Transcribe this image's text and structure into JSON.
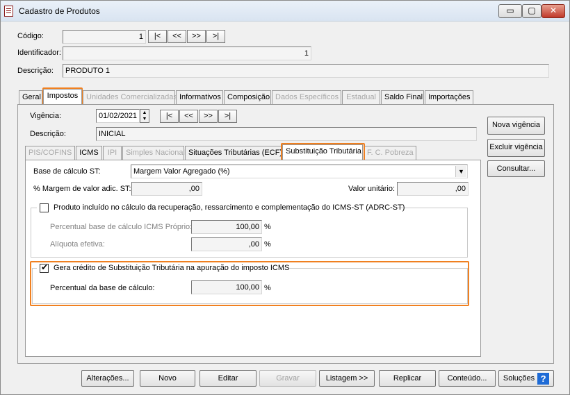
{
  "window": {
    "title": "Cadastro de Produtos",
    "minimize": "▭",
    "restore": "▢",
    "close": "✕"
  },
  "header": {
    "codigo_label": "Código:",
    "codigo_value": "1",
    "nav": [
      "|<",
      "<<",
      ">>",
      ">|"
    ],
    "identificador_label": "Identificador:",
    "identificador_value": "1",
    "descricao_label": "Descrição:",
    "descricao_value": "PRODUTO 1"
  },
  "tabs": [
    {
      "label": "Geral",
      "enabled": true
    },
    {
      "label": "Impostos",
      "enabled": true,
      "active": true
    },
    {
      "label": "Unidades Comercializadas",
      "enabled": false
    },
    {
      "label": "Informativos",
      "enabled": true
    },
    {
      "label": "Composição",
      "enabled": true
    },
    {
      "label": "Dados Específicos",
      "enabled": false
    },
    {
      "label": "Estadual",
      "enabled": false
    },
    {
      "label": "Saldo Final",
      "enabled": true
    },
    {
      "label": "Importações",
      "enabled": true
    }
  ],
  "impostos": {
    "vigencia_label": "Vigência:",
    "vigencia_value": "01/02/2021",
    "nav": [
      "|<",
      "<<",
      ">>",
      ">|"
    ],
    "descricao_label": "Descrição:",
    "descricao_value": "INICIAL",
    "side_buttons": [
      "Nova vigência",
      "Excluir vigência",
      "Consultar..."
    ]
  },
  "subtabs": [
    {
      "label": "PIS/COFINS",
      "enabled": false
    },
    {
      "label": "ICMS",
      "enabled": true
    },
    {
      "label": "IPI",
      "enabled": false
    },
    {
      "label": "Simples Nacional",
      "enabled": false
    },
    {
      "label": "Situações Tributárias (ECF)",
      "enabled": true
    },
    {
      "label": "Substituição Tributária",
      "enabled": true,
      "active": true
    },
    {
      "label": "F. C. Pobreza",
      "enabled": false
    }
  ],
  "st": {
    "base_label": "Base de cálculo ST:",
    "base_value": "Margem Valor Agregado (%)",
    "margem_label": "% Margem de valor adic. ST:",
    "margem_value": ",00",
    "valor_unit_label": "Valor unitário:",
    "valor_unit_value": ",00",
    "adrc_label": "Produto incluído no cálculo da recuperação, ressarcimento e complementação do ICMS-ST (ADRC-ST)",
    "adrc_checked": false,
    "perc_base_label": "Percentual base de cálculo ICMS Próprio:",
    "perc_base_value": "100,00",
    "aliquota_label": "Alíquota efetiva:",
    "aliquota_value": ",00",
    "percent_sign": "%",
    "gera_credito_label": "Gera crédito de Substituição Tributária na apuração do imposto ICMS",
    "gera_credito_checked": true,
    "perc_bc_label": "Percentual da base de cálculo:",
    "perc_bc_value": "100,00"
  },
  "footer": {
    "buttons": [
      {
        "label": "Alterações...",
        "enabled": true
      },
      {
        "label": "Novo",
        "enabled": true
      },
      {
        "label": "Editar",
        "enabled": true
      },
      {
        "label": "Gravar",
        "enabled": false
      },
      {
        "label": "Listagem >>",
        "enabled": true
      },
      {
        "label": "Replicar",
        "enabled": true
      },
      {
        "label": "Conteúdo...",
        "enabled": true
      }
    ],
    "solucoes": "Soluções",
    "help": "?"
  },
  "colors": {
    "highlight": "#f08020",
    "help_blue": "#1e6bd6"
  }
}
